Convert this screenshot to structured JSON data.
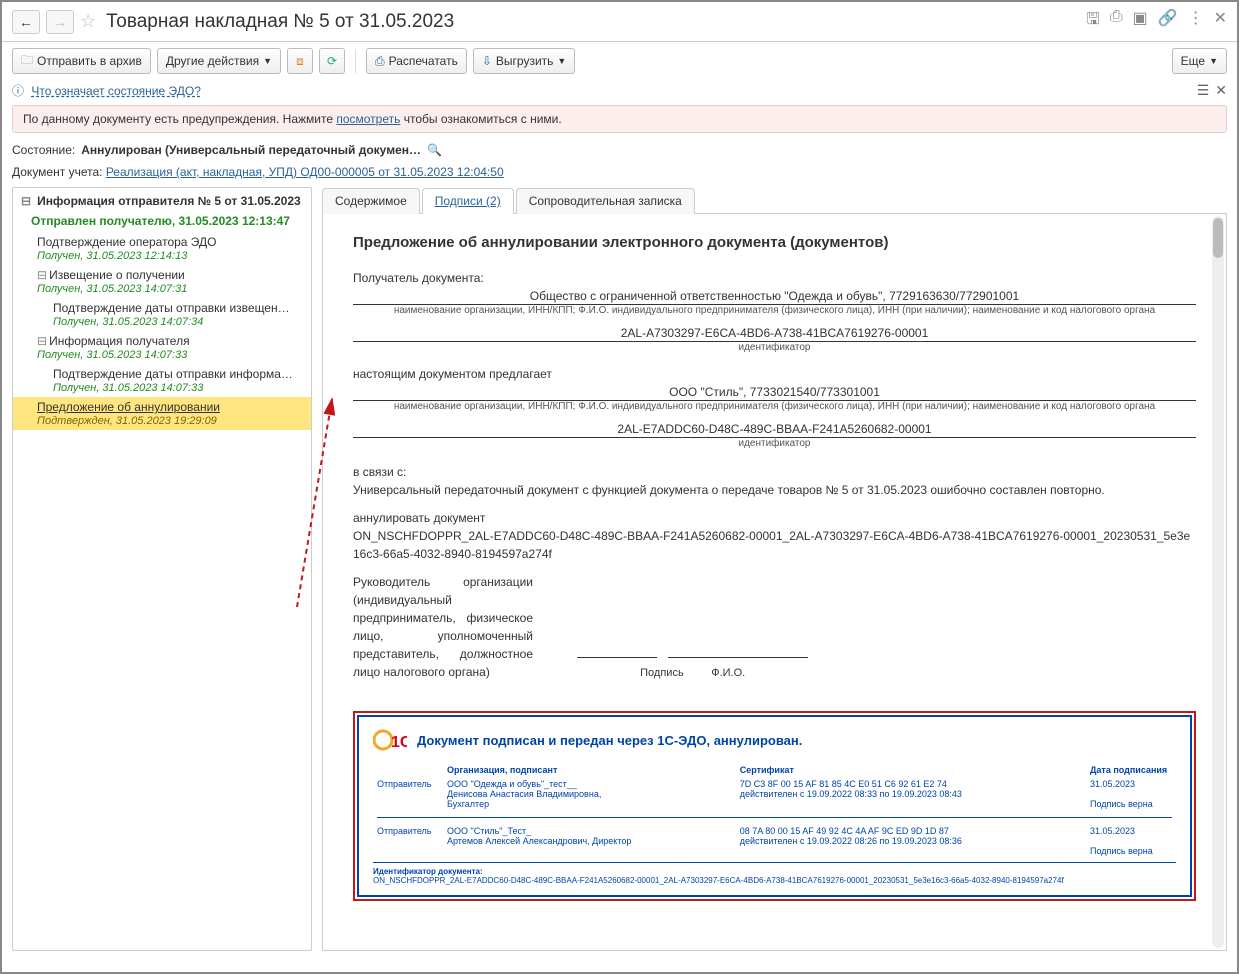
{
  "title": "Товарная накладная № 5 от 31.05.2023",
  "toolbar": {
    "archive": "Отправить в архив",
    "other": "Другие действия",
    "print": "Распечатать",
    "export": "Выгрузить",
    "more": "Еще"
  },
  "edo_link": "Что означает состояние ЭДО?",
  "warning": {
    "prefix": "По данному документу есть предупреждения. Нажмите ",
    "link": "посмотреть",
    "suffix": " чтобы ознакомиться с ними."
  },
  "state": {
    "label": "Состояние:",
    "value": "Аннулирован (Универсальный передаточный докумен…"
  },
  "accounting_doc": {
    "label": "Документ учета:",
    "link": "Реализация (акт, накладная, УПД) ОД00-000005 от 31.05.2023 12:04:50"
  },
  "tree": {
    "header": "Информация отправителя № 5 от 31.05.2023",
    "status": "Отправлен получателю, 31.05.2023 12:13:47",
    "items": [
      {
        "label": "Подтверждение оператора ЭДО",
        "received": "Получен, 31.05.2023 12:14:13",
        "indent": 0
      },
      {
        "label": "Извещение о получении",
        "received": "Получен, 31.05.2023 14:07:31",
        "indent": 0,
        "toggle": true
      },
      {
        "label": "Подтверждение даты отправки извещен…",
        "received": "Получен, 31.05.2023 14:07:34",
        "indent": 1
      },
      {
        "label": "Информация получателя",
        "received": "Получен, 31.05.2023 14:07:33",
        "indent": 0,
        "toggle": true
      },
      {
        "label": "Подтверждение даты отправки информа…",
        "received": "Получен, 31.05.2023 14:07:33",
        "indent": 1
      },
      {
        "label": "Предложение об аннулировании",
        "received": "Подтвержден, 31.05.2023 19:29:09",
        "indent": 0,
        "highlight": true
      }
    ]
  },
  "tabs": {
    "content": "Содержимое",
    "signatures": "Подписи (2)",
    "note": "Сопроводительная записка"
  },
  "doc": {
    "title": "Предложение об аннулировании электронного документа (документов)",
    "recipient_label": "Получатель документа:",
    "recipient_name": "Общество с ограниченной ответственностью \"Одежда и обувь\", 7729163630/772901001",
    "org_caption": "наименование организации, ИНН/КПП; Ф.И.О. индивидуального предпринимателя (физического лица), ИНН (при наличии); наименование и код налогового органа",
    "recipient_id": "2AL-A7303297-E6CA-4BD6-A738-41BCA7619276-00001",
    "id_caption": "идентификатор",
    "proposes": "настоящим документом предлагает",
    "sender_name": "ООО \"Стиль\", 7733021540/773301001",
    "sender_id": "2AL-E7ADDC60-D48C-489C-BBAA-F241A5260682-00001",
    "reason_label": "в связи с:",
    "reason": "Универсальный передаточный документ с функцией документа о передаче товаров № 5 от 31.05.2023 ошибочно составлен повторно.",
    "annul_label": "аннулировать документ",
    "annul_file": "ON_NSCHFDOPPR_2AL-E7ADDC60-D48C-489C-BBAA-F241A5260682-00001_2AL-A7303297-E6CA-4BD6-A738-41BCA7619276-00001_20230531_5e3e16c3-66a5-4032-8940-8194597a274f",
    "director_block": "Руководитель организации (индивидуальный предприниматель, физическое лицо, уполномоченный представитель, должностное лицо налогового органа)",
    "sig_label": "Подпись",
    "fio_label": "Ф.И.О.",
    "stamp": {
      "header": "Документ подписан и передан через 1С-ЭДО, аннулирован.",
      "cols": {
        "role": "",
        "org": "Организация, подписант",
        "cert": "Сертификат",
        "date": "Дата подписания"
      },
      "rows": [
        {
          "role": "Отправитель",
          "org": "ООО \"Одежда и обувь\"_тест__\nДенисова Анастасия Владимировна,\nБухгалтер",
          "cert": "7D C3 8F 00 15 AF 81 85 4C E0 51 C6 92 61 E2 74\nдействителен с 19.09.2022 08:33 по 19.09.2023 08:43",
          "date": "31.05.2023",
          "valid": "Подпись верна"
        },
        {
          "role": "Отправитель",
          "org": "ООО \"Стиль\"_Тест_\nАртемов Алексей Александрович, Директор",
          "cert": "08 7A 80 00 15 AF 49 92 4C 4A AF 9C ED 9D 1D 87\nдействителен с 19.09.2022 08:26 по 19.09.2023 08:36",
          "date": "31.05.2023",
          "valid": "Подпись верна"
        }
      ],
      "ident_label": "Идентификатор документа:",
      "ident": "ON_NSCHFDOPPR_2AL-E7ADDC60-D48C-489C-BBAA-F241A5260682-00001_2AL-A7303297-E6CA-4BD6-A738-41BCA7619276-00001_20230531_5e3e16c3-66a5-4032-8940-8194597a274f"
    }
  }
}
